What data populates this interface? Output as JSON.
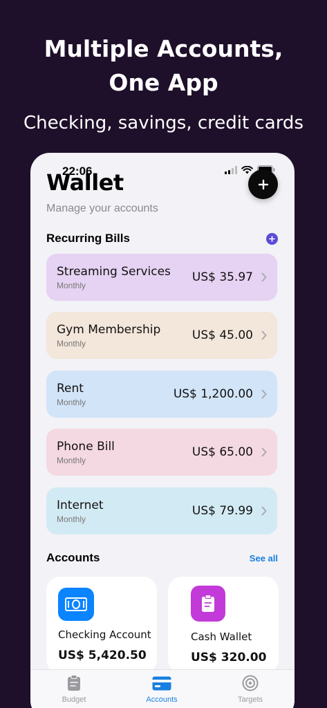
{
  "promo": {
    "title_line1": "Multiple Accounts,",
    "title_line2": "One App",
    "subtitle": "Checking, savings, credit cards"
  },
  "status_bar": {
    "time": "22:06"
  },
  "header": {
    "title": "Wallet",
    "subtitle": "Manage your accounts",
    "add_icon": "plus-icon"
  },
  "recurring": {
    "heading": "Recurring Bills",
    "add_icon": "plus-circle-icon",
    "bills": [
      {
        "name": "Streaming Services",
        "frequency": "Monthly",
        "amount": "US$ 35.97",
        "color": "#e6d2f2"
      },
      {
        "name": "Gym Membership",
        "frequency": "Monthly",
        "amount": "US$ 45.00",
        "color": "#f3e6da"
      },
      {
        "name": "Rent",
        "frequency": "Monthly",
        "amount": "US$ 1,200.00",
        "color": "#d2e4f7"
      },
      {
        "name": "Phone Bill",
        "frequency": "Monthly",
        "amount": "US$ 65.00",
        "color": "#f4d8e2"
      },
      {
        "name": "Internet",
        "frequency": "Monthly",
        "amount": "US$ 79.99",
        "color": "#d2eaf3"
      }
    ]
  },
  "accounts": {
    "heading": "Accounts",
    "see_all": "See all",
    "items": [
      {
        "name": "Checking Account",
        "balance": "US$ 5,420.50",
        "icon": "banknote-icon",
        "color": "#0a84ff"
      },
      {
        "name": "Cash Wallet",
        "balance": "US$ 320.00",
        "icon": "clipboard-icon",
        "color": "#c23ad8"
      }
    ]
  },
  "tabbar": {
    "tabs": [
      {
        "label": "Budget",
        "icon": "budget-icon"
      },
      {
        "label": "Accounts",
        "icon": "card-icon",
        "active": true
      },
      {
        "label": "Targets",
        "icon": "target-icon"
      }
    ]
  },
  "colors": {
    "background": "#1e0f2a",
    "accent": "#1a7fe0",
    "purple": "#5b4bd8"
  }
}
